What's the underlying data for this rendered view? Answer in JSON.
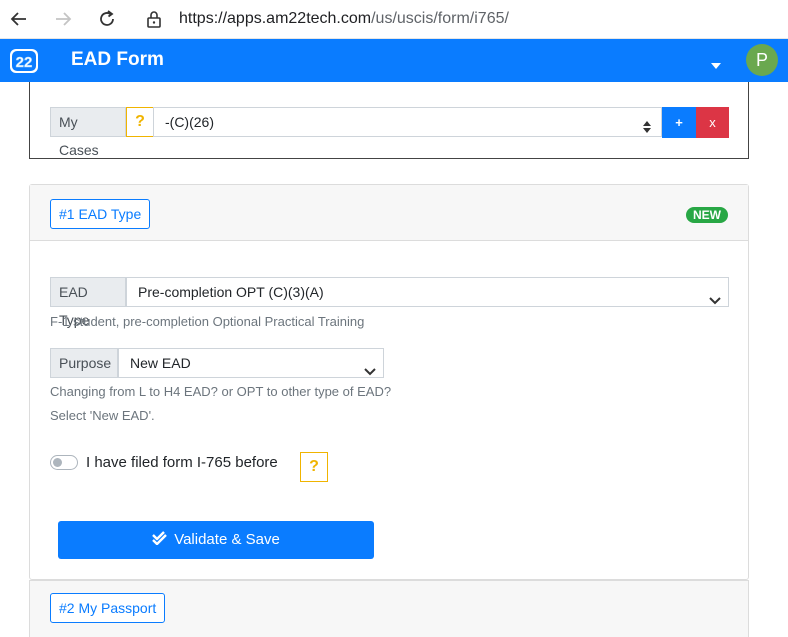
{
  "browser": {
    "url_host": "https://apps.am22tech.com",
    "url_path": "/us/uscis/form/i765/"
  },
  "navbar": {
    "logo_text": "22",
    "title": "EAD Form",
    "avatar_letter": "P"
  },
  "cases": {
    "label": "My Cases",
    "help": "?",
    "selected": "-(C)(26)",
    "add_label": "+",
    "remove_label": "x"
  },
  "ead_section": {
    "header_button": "#1 EAD Type",
    "badge": "NEW",
    "ead_type_label": "EAD Type",
    "ead_type_selected": "Pre-completion OPT (C)(3)(A)",
    "ead_type_help": "F-1 student, pre-completion Optional Practical Training",
    "purpose_label": "Purpose",
    "purpose_selected": "New EAD",
    "purpose_help_1": "Changing from L to H4 EAD? or OPT to other type of EAD?",
    "purpose_help_2": "Select 'New EAD'.",
    "toggle_label": "I have filed form I-765 before",
    "toggle_on": false,
    "toggle_help": "?",
    "save_button": "Validate & Save"
  },
  "passport_section": {
    "header_button": "#2 My Passport"
  },
  "colors": {
    "primary": "#0a7cff",
    "danger": "#dc3545",
    "success": "#28a745",
    "warning": "#f0b400",
    "avatar": "#6aa84f"
  }
}
